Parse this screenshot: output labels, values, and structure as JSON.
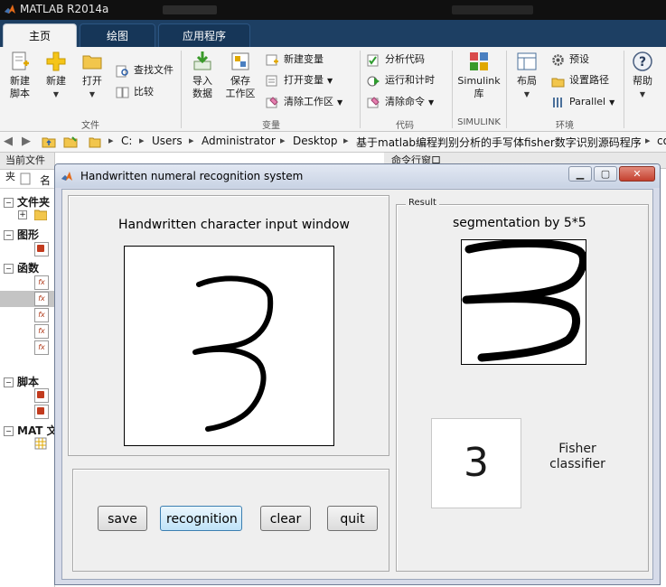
{
  "app": {
    "title": "MATLAB R2014a"
  },
  "tabs": [
    {
      "label": "主页"
    },
    {
      "label": "绘图"
    },
    {
      "label": "应用程序"
    }
  ],
  "ribbon": {
    "file": {
      "section_label": "文件",
      "new_script": "新建\n脚本",
      "new": "新建",
      "open": "打开",
      "find_files": "查找文件",
      "compare": "比较"
    },
    "variable": {
      "section_label": "变量",
      "import_data": "导入\n数据",
      "save_workspace": "保存\n工作区",
      "new_variable": "新建变量",
      "open_variable": "打开变量",
      "clear_workspace": "清除工作区"
    },
    "code": {
      "section_label": "代码",
      "analyze_code": "分析代码",
      "run_and_time": "运行和计时",
      "clear_commands": "清除命令"
    },
    "simulink": {
      "section_label": "SIMULINK",
      "library": "Simulink\n库"
    },
    "environment": {
      "section_label": "环境",
      "layout": "布局",
      "preferences": "预设",
      "set_path": "设置路径",
      "parallel": "Parallel"
    },
    "help": {
      "label": "帮助"
    }
  },
  "address": {
    "crumbs": [
      "C:",
      "Users",
      "Administrator",
      "Desktop",
      "基于matlab编程判别分析的手写体fisher数字识别源码程序",
      "co"
    ]
  },
  "left_panel": {
    "title": "当前文件夹",
    "column_header": "名",
    "sections": [
      "文件夹",
      "图形",
      "函数",
      "脚本",
      "MAT 文"
    ]
  },
  "right_panel": {
    "title": "命令行窗口"
  },
  "figure": {
    "title": "Handwritten numeral recognition system",
    "input_title": "Handwritten character input window",
    "result_group": "Result",
    "seg_title": "segmentation by 5*5",
    "result_digit": "3",
    "classifier_label": "Fisher\nclassifier",
    "buttons": {
      "save": "save",
      "recognition": "recognition",
      "clear": "clear",
      "quit": "quit"
    }
  }
}
